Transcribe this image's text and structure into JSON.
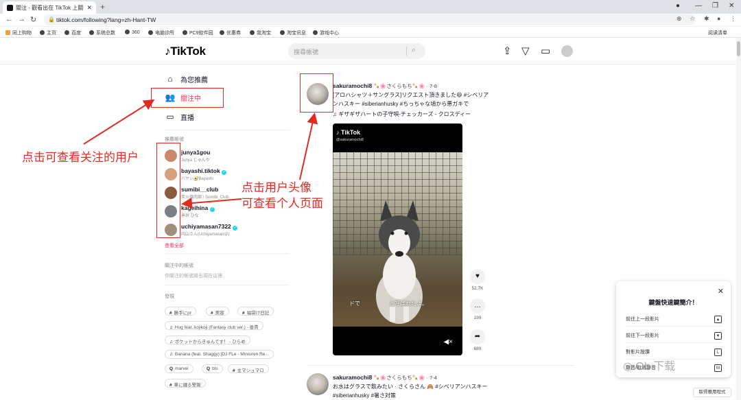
{
  "browser": {
    "tab_title": "關注 - 觀看出在 TikTok 上關注的",
    "tab_close": "✕",
    "new_tab": "+",
    "url": "tiktok.com/following?lang=zh-Hant-TW",
    "bookmarks": [
      "同上购物",
      "主页",
      "百度",
      "系统总数",
      "360",
      "电脑诊所",
      "PC9软件园",
      "优惠券",
      "我淘宝",
      "淘宝讯息",
      "游戏中心"
    ],
    "reading_list": "阅读清单"
  },
  "header": {
    "logo": "TikTok",
    "search_placeholder": "搜尋帳號"
  },
  "sidebar": {
    "nav": [
      {
        "label": "為您推薦",
        "icon": "home-icon"
      },
      {
        "label": "關注中",
        "icon": "following-icon"
      },
      {
        "label": "直播",
        "icon": "live-icon"
      }
    ],
    "recommended_title": "推薦帳號",
    "accounts": [
      {
        "name": "junya1gou",
        "sub": "Junya じゅんや",
        "verified": false,
        "color": "#c98a6a"
      },
      {
        "name": "bayashi.tiktok",
        "sub": "バヤシ🥑Bayashi",
        "verified": true,
        "color": "#d5a07c"
      },
      {
        "name": "sumibi__club",
        "sub": "炭火焼肉部 / Sumibi_Club",
        "verified": false,
        "color": "#8a5a40"
      },
      {
        "name": "kageihina",
        "sub": "景井 ひな",
        "verified": true,
        "color": "#7b7f86"
      },
      {
        "name": "uchiyamasan7322",
        "sub": "内山さん(Uchiyamasan😜)",
        "verified": true,
        "color": "#a08f7c"
      }
    ],
    "see_all": "查看全部",
    "following_title": "關注中的帳號",
    "following_empty": "你關注的帳號將出現在這裡",
    "discover_title": "發現",
    "tags": [
      {
        "sym": "#",
        "text": "勝手にpr"
      },
      {
        "sym": "#",
        "text": "美容"
      },
      {
        "sym": "#",
        "text": "福袋け日記"
      },
      {
        "sym": "♫",
        "text": "Hug feat. kojikoji (Fantasy club ver.) - 壺貴"
      },
      {
        "sym": "♫",
        "text": "ポケットからきゅんです！ - ひらめ"
      },
      {
        "sym": "♫",
        "text": "Banana (feat. Shaggy) [DJ FLe - Minisiren Re..."
      },
      {
        "sym": "Q",
        "text": "marvel"
      },
      {
        "sym": "Q",
        "text": "bts"
      },
      {
        "sym": "#",
        "text": "主マシュマロ"
      },
      {
        "sym": "#",
        "text": "車に纏る警報"
      }
    ]
  },
  "post": {
    "username": "sakuramochi8",
    "nickname": "🍡🌸さくらもち🍡🌸 · 7-8",
    "caption_line1": "[アロハシャツ＋サングラス]リクエスト頂きました😆 #シベリア",
    "caption_line2": "ンハスキー #siberianhusky #ちっちゃな頃から悪ガキで",
    "music": "♫ ギザギザハートの子守唄-チェッカーズ - クロスディー",
    "video_logo": "TikTok",
    "video_handle": "@sakuramochi8",
    "video_subtitle_left": "ドで",
    "video_subtitle_right": "と呼ばれたよ。",
    "likes": "52.7K",
    "comments": "199",
    "shares": "689"
  },
  "post2": {
    "username": "sakuramochi8",
    "nickname": "🍡🌸さくらもち🍡🌸 · 7-4",
    "caption_line1": "お水はグラスで飲みたい · さくらさん 🙈 #シベリアンハスキー",
    "caption_line2": "#siberianhusky #暑さ対策"
  },
  "popup": {
    "title": "鍵盤快速鍵簡介！",
    "close": "✕",
    "rows": [
      {
        "label": "前往上一段影片",
        "key": "▲"
      },
      {
        "label": "前往下一段影片",
        "key": "▼"
      },
      {
        "label": "對影片按讚",
        "key": "L"
      },
      {
        "label": "靜音/取消靜音",
        "key": "M"
      }
    ]
  },
  "get_app": "取得應用程式",
  "watermark": "◎ Ob 下载",
  "annotations": {
    "left": "点击可查看关注的用户",
    "right_line1": "点击用户头像",
    "right_line2": "可查看个人页面"
  }
}
